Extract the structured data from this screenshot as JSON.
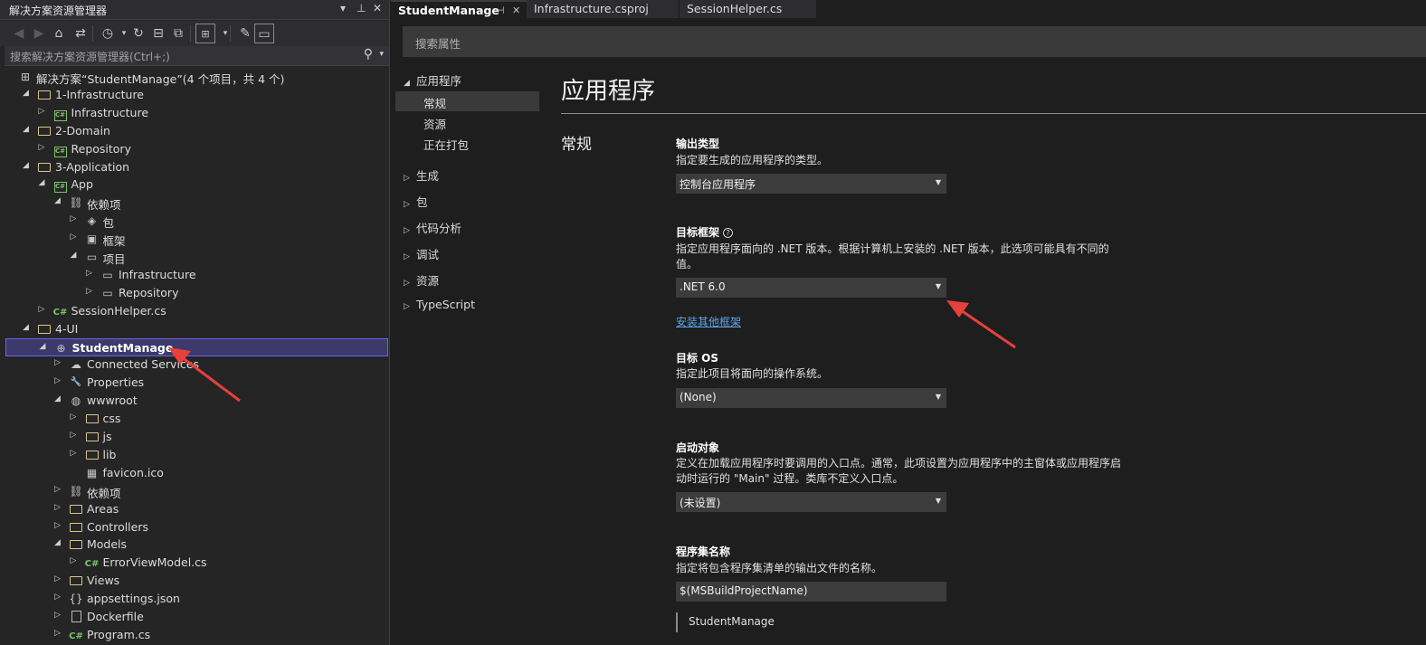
{
  "solution_explorer": {
    "title": "解决方案资源管理器",
    "title_controls": {
      "dropdown": "▾",
      "pin": "⊥",
      "close": "✕"
    },
    "search_placeholder": "搜索解决方案资源管理器(Ctrl+;)",
    "tree": [
      {
        "label": "解决方案“StudentManage”(4 个项目，共 4 个)",
        "icon": "solution-icon",
        "expander": ""
      },
      {
        "label": "1-Infrastructure",
        "icon": "folder-icon",
        "expander": "◢"
      },
      {
        "label": "Infrastructure",
        "icon": "csharp-project-icon",
        "expander": "▷"
      },
      {
        "label": "2-Domain",
        "icon": "folder-icon",
        "expander": "◢"
      },
      {
        "label": "Repository",
        "icon": "csharp-project-icon",
        "expander": "▷"
      },
      {
        "label": "3-Application",
        "icon": "folder-icon",
        "expander": "◢"
      },
      {
        "label": "App",
        "icon": "csharp-project-icon",
        "expander": "◢"
      },
      {
        "label": "依赖项",
        "icon": "dependencies-icon",
        "expander": "◢"
      },
      {
        "label": "包",
        "icon": "package-icon",
        "expander": "▷"
      },
      {
        "label": "框架",
        "icon": "framework-icon",
        "expander": "▷"
      },
      {
        "label": "项目",
        "icon": "project-reference-icon",
        "expander": "◢"
      },
      {
        "label": "Infrastructure",
        "icon": "project-reference-icon",
        "expander": "▷"
      },
      {
        "label": "Repository",
        "icon": "project-reference-icon",
        "expander": "▷"
      },
      {
        "label": "SessionHelper.cs",
        "icon": "csharp-file-icon",
        "expander": "▷"
      },
      {
        "label": "4-UI",
        "icon": "folder-icon",
        "expander": "◢"
      },
      {
        "label": "StudentManage",
        "icon": "web-project-icon",
        "expander": "◢"
      },
      {
        "label": "Connected Services",
        "icon": "connected-services-icon",
        "expander": "▷"
      },
      {
        "label": "Properties",
        "icon": "properties-icon",
        "expander": "▷"
      },
      {
        "label": "wwwroot",
        "icon": "globe-icon",
        "expander": "◢"
      },
      {
        "label": "css",
        "icon": "folder-icon",
        "expander": "▷"
      },
      {
        "label": "js",
        "icon": "folder-icon",
        "expander": "▷"
      },
      {
        "label": "lib",
        "icon": "folder-icon",
        "expander": "▷"
      },
      {
        "label": "favicon.ico",
        "icon": "icon-file-icon",
        "expander": ""
      },
      {
        "label": "依赖项",
        "icon": "dependencies-icon",
        "expander": "▷"
      },
      {
        "label": "Areas",
        "icon": "folder-icon",
        "expander": "▷"
      },
      {
        "label": "Controllers",
        "icon": "folder-icon",
        "expander": "▷"
      },
      {
        "label": "Models",
        "icon": "folder-icon",
        "expander": "◢"
      },
      {
        "label": "ErrorViewModel.cs",
        "icon": "csharp-file-icon",
        "expander": "▷"
      },
      {
        "label": "Views",
        "icon": "folder-icon",
        "expander": "▷"
      },
      {
        "label": "appsettings.json",
        "icon": "json-file-icon",
        "expander": "▷"
      },
      {
        "label": "Dockerfile",
        "icon": "file-icon",
        "expander": "▷"
      },
      {
        "label": "Program.cs",
        "icon": "csharp-file-icon",
        "expander": "▷"
      }
    ]
  },
  "tabs": [
    {
      "label": "StudentManage",
      "pin": "⊣",
      "close": "✕"
    },
    {
      "label": "Infrastructure.csproj"
    },
    {
      "label": "SessionHelper.cs"
    }
  ],
  "properties": {
    "search_placeholder": "搜索属性",
    "nav": [
      {
        "label": "应用程序",
        "arrow": "◢"
      },
      {
        "label": "常规"
      },
      {
        "label": "资源"
      },
      {
        "label": "正在打包"
      },
      {
        "label": "生成",
        "arrow": "▷"
      },
      {
        "label": "包",
        "arrow": "▷"
      },
      {
        "label": "代码分析",
        "arrow": "▷"
      },
      {
        "label": "调试",
        "arrow": "▷"
      },
      {
        "label": "资源",
        "arrow": "▷"
      },
      {
        "label": "TypeScript",
        "arrow": "▷"
      }
    ],
    "heading": "应用程序",
    "section": "常规",
    "output_type": {
      "title": "输出类型",
      "desc": "指定要生成的应用程序的类型。",
      "value": "控制台应用程序"
    },
    "target_framework": {
      "title": "目标框架",
      "info": "?",
      "desc": "指定应用程序面向的 .NET 版本。根据计算机上安装的 .NET 版本，此选项可能具有不同的值。",
      "value": ".NET 6.0",
      "link": "安装其他框架"
    },
    "target_os": {
      "title": "目标 OS",
      "desc": "指定此项目将面向的操作系统。",
      "value": "(None)"
    },
    "startup_object": {
      "title": "启动对象",
      "desc": "定义在加载应用程序时要调用的入口点。通常，此项设置为应用程序中的主窗体或应用程序启动时运行的 \"Main\" 过程。类库不定义入口点。",
      "value": "(未设置)"
    },
    "assembly_name": {
      "title": "程序集名称",
      "desc": "指定将包含程序集清单的输出文件的名称。",
      "value": "$(MSBuildProjectName)",
      "preview": "StudentManage"
    }
  },
  "annotation_color": "#e8403a"
}
